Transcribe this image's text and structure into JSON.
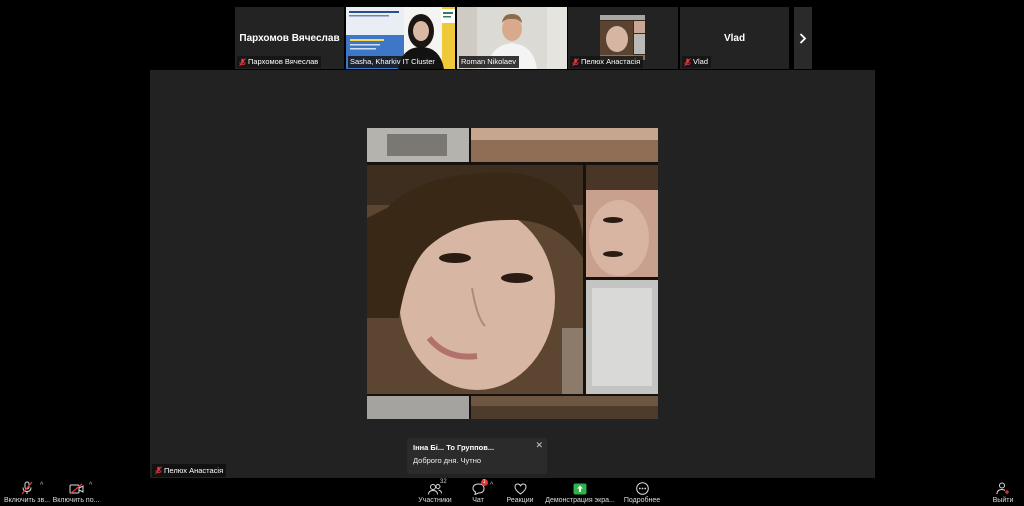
{
  "gallery": {
    "tiles": [
      {
        "name": "Пархомов Вячеслав",
        "tag": "Пархомов Вячеслав",
        "muted": true
      },
      {
        "name": "",
        "tag": "Sasha, Kharkiv IT Cluster",
        "muted": false
      },
      {
        "name": "",
        "tag": "Roman Nikolaev",
        "muted": false
      },
      {
        "name": "",
        "tag": "Пелюх Анастасія",
        "muted": true
      },
      {
        "name": "Vlad",
        "tag": "Vlad",
        "muted": true
      }
    ],
    "next_icon": "chevron-right-icon"
  },
  "main": {
    "speaker_tag": "Пелюх Анастасія"
  },
  "toast": {
    "title": "Інна Бі... То Группов...",
    "text": "Доброго дня. Чутно"
  },
  "toolbar": {
    "mic_label": "Включить зв...",
    "video_label": "Включить по...",
    "participants_label": "Участники",
    "participants_count": "32",
    "chat_label": "Чат",
    "chat_badge": "1",
    "reactions_label": "Реакции",
    "share_label": "Демонстрация экра...",
    "more_label": "Подробнее",
    "leave_label": "Выйти"
  },
  "colors": {
    "active_tile_border": "#c8d84a",
    "mute_red": "#e0383e",
    "share_green": "#2fb34a"
  }
}
